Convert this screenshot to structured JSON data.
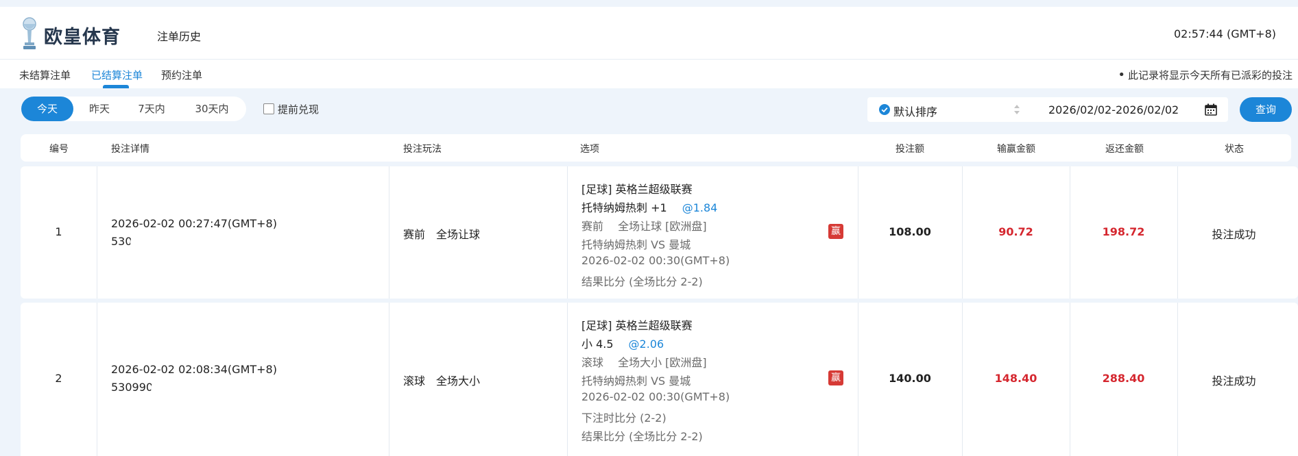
{
  "header": {
    "brand": "欧皇体育",
    "nav_link": "注单历史",
    "clock": "02:57:44 (GMT+8)"
  },
  "tabs": {
    "items": [
      "未结算注单",
      "已结算注单",
      "预约注单"
    ],
    "active_index": 1,
    "notice": "此记录将显示今天所有已派彩的投注"
  },
  "filters": {
    "periods": [
      "今天",
      "昨天",
      "7天内",
      "30天内"
    ],
    "active_period": 0,
    "early_cashout_label": "提前兑现",
    "sort_label": "默认排序",
    "date_range": "2026/02/02-2026/02/02",
    "query_label": "查询"
  },
  "table": {
    "columns": [
      "编号",
      "投注详情",
      "投注玩法",
      "选项",
      "投注额",
      "输赢金额",
      "返还金额",
      "状态"
    ],
    "rows": [
      {
        "no": "1",
        "time": "2026-02-02 00:27:47(GMT+8)",
        "bet_id_partial": "530",
        "play": "赛前　全场让球",
        "selection": {
          "league": "[足球] 英格兰超级联赛",
          "pick": "托特纳姆热刺 +1",
          "odds": "@1.84",
          "market": "赛前　 全场让球 [欧洲盘]",
          "match": "托特纳姆热刺 VS 曼城",
          "kickoff": "2026-02-02 00:30(GMT+8)",
          "extra": "",
          "result": "结果比分 (全场比分 2-2)"
        },
        "win_badge": "赢",
        "stake": "108.00",
        "win_loss": "90.72",
        "return": "198.72",
        "status": "投注成功"
      },
      {
        "no": "2",
        "time": "2026-02-02 02:08:34(GMT+8)",
        "bet_id_partial": "530990",
        "play": "滚球　全场大小",
        "selection": {
          "league": "[足球] 英格兰超级联赛",
          "pick": "小 4.5",
          "odds": "@2.06",
          "market": "滚球　 全场大小 [欧洲盘]",
          "match": "托特纳姆热刺 VS 曼城",
          "kickoff": "2026-02-02 00:30(GMT+8)",
          "extra": "下注时比分 (2-2)",
          "result": "结果比分 (全场比分 2-2)"
        },
        "win_badge": "赢",
        "stake": "140.00",
        "win_loss": "148.40",
        "return": "288.40",
        "status": "投注成功"
      }
    ]
  },
  "colors": {
    "accent": "#1c86d8",
    "win_red": "#d5272f",
    "page_bg": "#eef4fb"
  },
  "icons": {
    "logo": "trophy-logo-icon",
    "sort": "check-circle-icon",
    "sort_arrows": "sort-arrows-icon",
    "calendar": "calendar-icon"
  }
}
